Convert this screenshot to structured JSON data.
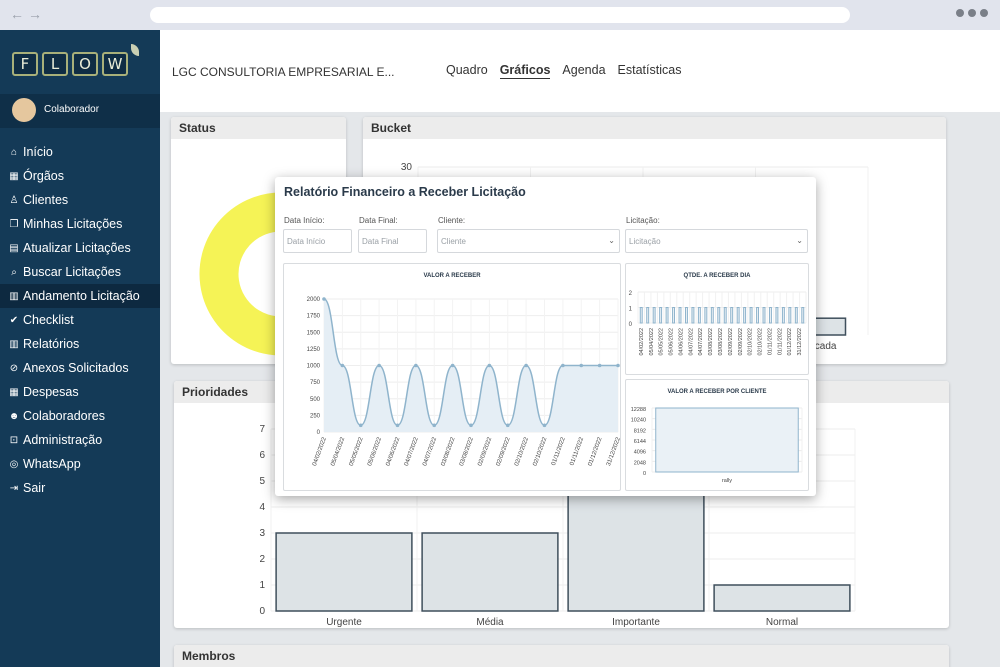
{
  "sidebar": {
    "logo_letters": [
      "F",
      "L",
      "O",
      "W"
    ],
    "user": "Colaborador",
    "items": [
      {
        "label": "Início",
        "icon": "home-icon"
      },
      {
        "label": "Órgãos",
        "icon": "bank-icon"
      },
      {
        "label": "Clientes",
        "icon": "person-icon"
      },
      {
        "label": "Minhas Licitações",
        "icon": "copy-icon"
      },
      {
        "label": "Atualizar Licitações",
        "icon": "card-icon"
      },
      {
        "label": "Buscar Licitações",
        "icon": "search-icon"
      },
      {
        "label": "Andamento Licitação",
        "icon": "chart-icon"
      },
      {
        "label": "Checklist",
        "icon": "check-icon"
      },
      {
        "label": "Relatórios",
        "icon": "chart-icon"
      },
      {
        "label": "Anexos Solicitados",
        "icon": "paperclip-icon"
      },
      {
        "label": "Despesas",
        "icon": "calculator-icon"
      },
      {
        "label": "Colaboradores",
        "icon": "users-icon"
      },
      {
        "label": "Administração",
        "icon": "lock-icon"
      },
      {
        "label": "WhatsApp",
        "icon": "whatsapp-icon"
      },
      {
        "label": "Sair",
        "icon": "logout-icon"
      }
    ],
    "active_index": 6
  },
  "header": {
    "company": "LGC CONSULTORIA EMPRESARIAL E...",
    "tabs": [
      "Quadro",
      "Gráficos",
      "Agenda",
      "Estatísticas"
    ],
    "selected_tab": 1
  },
  "cards": {
    "status": "Status",
    "bucket": "Bucket",
    "prioridades": "Prioridades",
    "membros": "Membros"
  },
  "colors": {
    "sidebar": "#143a57",
    "yellow": "#f5f356",
    "red": "#ef4a52",
    "purple": "#9a6bd6",
    "bar_fill": "#dde3e6",
    "bar_stroke": "#3f4f5c",
    "line": "#8fb4cc"
  },
  "modal": {
    "title": "Relatório Financeiro a Receber Licitação",
    "fields": [
      {
        "label": "Data Início:",
        "placeholder": "Data Início"
      },
      {
        "label": "Data Final:",
        "placeholder": "Data Final"
      },
      {
        "label": "Cliente:",
        "placeholder": "Cliente"
      },
      {
        "label": "Licitação:",
        "placeholder": "Licitação"
      }
    ]
  },
  "chart_data": [
    {
      "id": "status",
      "type": "pie",
      "title": "Status",
      "series": [
        {
          "values": [
            84,
            2,
            1,
            13
          ]
        }
      ]
    },
    {
      "id": "bucket",
      "type": "bar",
      "title": "Bucket",
      "categories": [
        "Adjudicada"
      ],
      "values": [
        3
      ],
      "ylim": [
        0,
        30
      ],
      "yticks": [
        30
      ]
    },
    {
      "id": "prioridades",
      "type": "bar",
      "title": "Prioridades",
      "categories": [
        "Urgente",
        "Média",
        "Importante",
        "Normal"
      ],
      "values": [
        3,
        3,
        5,
        1
      ],
      "ylim": [
        0,
        7
      ],
      "yticks": [
        0,
        1,
        2,
        3,
        4,
        5,
        6,
        7
      ]
    },
    {
      "id": "valor_receber",
      "type": "line",
      "title": "VALOR A RECEBER",
      "x": [
        "04/02/2022",
        "05/04/2022",
        "05/05/2022",
        "05/06/2022",
        "04/06/2022",
        "04/07/2022",
        "04/07/2022",
        "03/08/2022",
        "03/08/2022",
        "02/09/2022",
        "02/09/2022",
        "02/10/2022",
        "02/10/2022",
        "01/11/2022",
        "01/11/2022",
        "01/12/2022",
        "31/12/2022"
      ],
      "values": [
        2000,
        1000,
        100,
        1000,
        100,
        1000,
        100,
        1000,
        100,
        1000,
        100,
        1000,
        100,
        1000,
        1000,
        1000,
        1000
      ],
      "ylim": [
        0,
        2000
      ],
      "yticks": [
        0,
        250,
        500,
        750,
        1000,
        1250,
        1500,
        1750,
        2000
      ]
    },
    {
      "id": "qtde_dia",
      "type": "bar",
      "title": "QTDE. A RECEBER DIA",
      "categories": [
        "04/02/2022",
        "05/04/2022",
        "05/05/2022",
        "05/06/2022",
        "04/06/2022",
        "04/07/2022",
        "04/07/2022",
        "03/08/2022",
        "03/08/2022",
        "02/09/2022",
        "02/09/2022",
        "02/10/2022",
        "02/10/2022",
        "01/11/2022",
        "01/11/2022",
        "01/12/2022",
        "31/12/2022"
      ],
      "values": [
        1,
        1,
        1,
        1,
        1,
        1,
        1,
        1,
        1,
        1,
        1,
        1,
        1,
        1,
        1,
        1,
        1,
        1,
        1,
        1,
        1,
        1,
        1,
        1,
        1,
        1
      ],
      "ylim": [
        0,
        2
      ],
      "yticks": [
        0,
        1,
        2
      ]
    },
    {
      "id": "valor_cliente",
      "type": "bar",
      "title": "VALOR A RECEBER POR CLIENTE",
      "categories": [
        "rally"
      ],
      "values": [
        12288
      ],
      "ylim": [
        0,
        12288
      ],
      "yticks": [
        0,
        2048,
        4096,
        6144,
        8192,
        10240,
        12288
      ]
    }
  ]
}
